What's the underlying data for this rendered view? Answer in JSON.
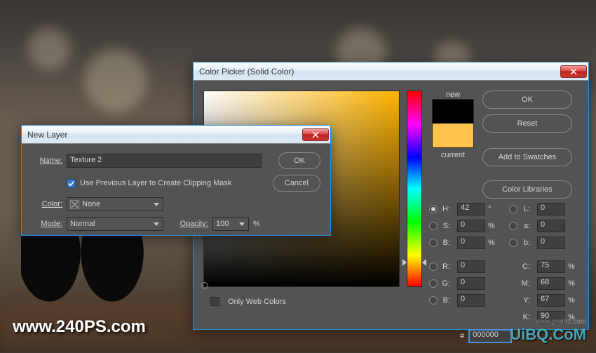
{
  "newLayer": {
    "title": "New Layer",
    "nameLabel": "Name:",
    "nameValue": "Texture 2",
    "clipMaskLabel": "Use Previous Layer to Create Clipping Mask",
    "clipMaskChecked": true,
    "colorLabel": "Color:",
    "colorValue": "None",
    "modeLabel": "Mode:",
    "modeValue": "Normal",
    "opacityLabel": "Opacity:",
    "opacityValue": "100",
    "opacityUnit": "%",
    "ok": "OK",
    "cancel": "Cancel"
  },
  "colorPicker": {
    "title": "Color Picker (Solid Color)",
    "newLabel": "new",
    "currentLabel": "current",
    "ok": "OK",
    "reset": "Reset",
    "addSwatches": "Add to Swatches",
    "colorLibraries": "Color Libraries",
    "onlyWeb": "Only Web Colors",
    "hexLabel": "#",
    "hexValue": "000000",
    "H": {
      "label": "H:",
      "value": "42",
      "unit": "°"
    },
    "S": {
      "label": "S:",
      "value": "0",
      "unit": "%"
    },
    "Bhsb": {
      "label": "B:",
      "value": "0",
      "unit": "%"
    },
    "R": {
      "label": "R:",
      "value": "0"
    },
    "G": {
      "label": "G:",
      "value": "0"
    },
    "Brgb": {
      "label": "B:",
      "value": "0"
    },
    "L": {
      "label": "L:",
      "value": "0"
    },
    "a": {
      "label": "a:",
      "value": "0"
    },
    "blab": {
      "label": "b:",
      "value": "0"
    },
    "C": {
      "label": "C:",
      "value": "75",
      "unit": "%"
    },
    "M": {
      "label": "M:",
      "value": "68",
      "unit": "%"
    },
    "Y": {
      "label": "Y:",
      "value": "67",
      "unit": "%"
    },
    "K": {
      "label": "K:",
      "value": "90",
      "unit": "%"
    }
  },
  "watermarks": {
    "main": "www.240PS.com",
    "sub": "www.psahz.com",
    "logo": "UiBQ.CoM"
  }
}
